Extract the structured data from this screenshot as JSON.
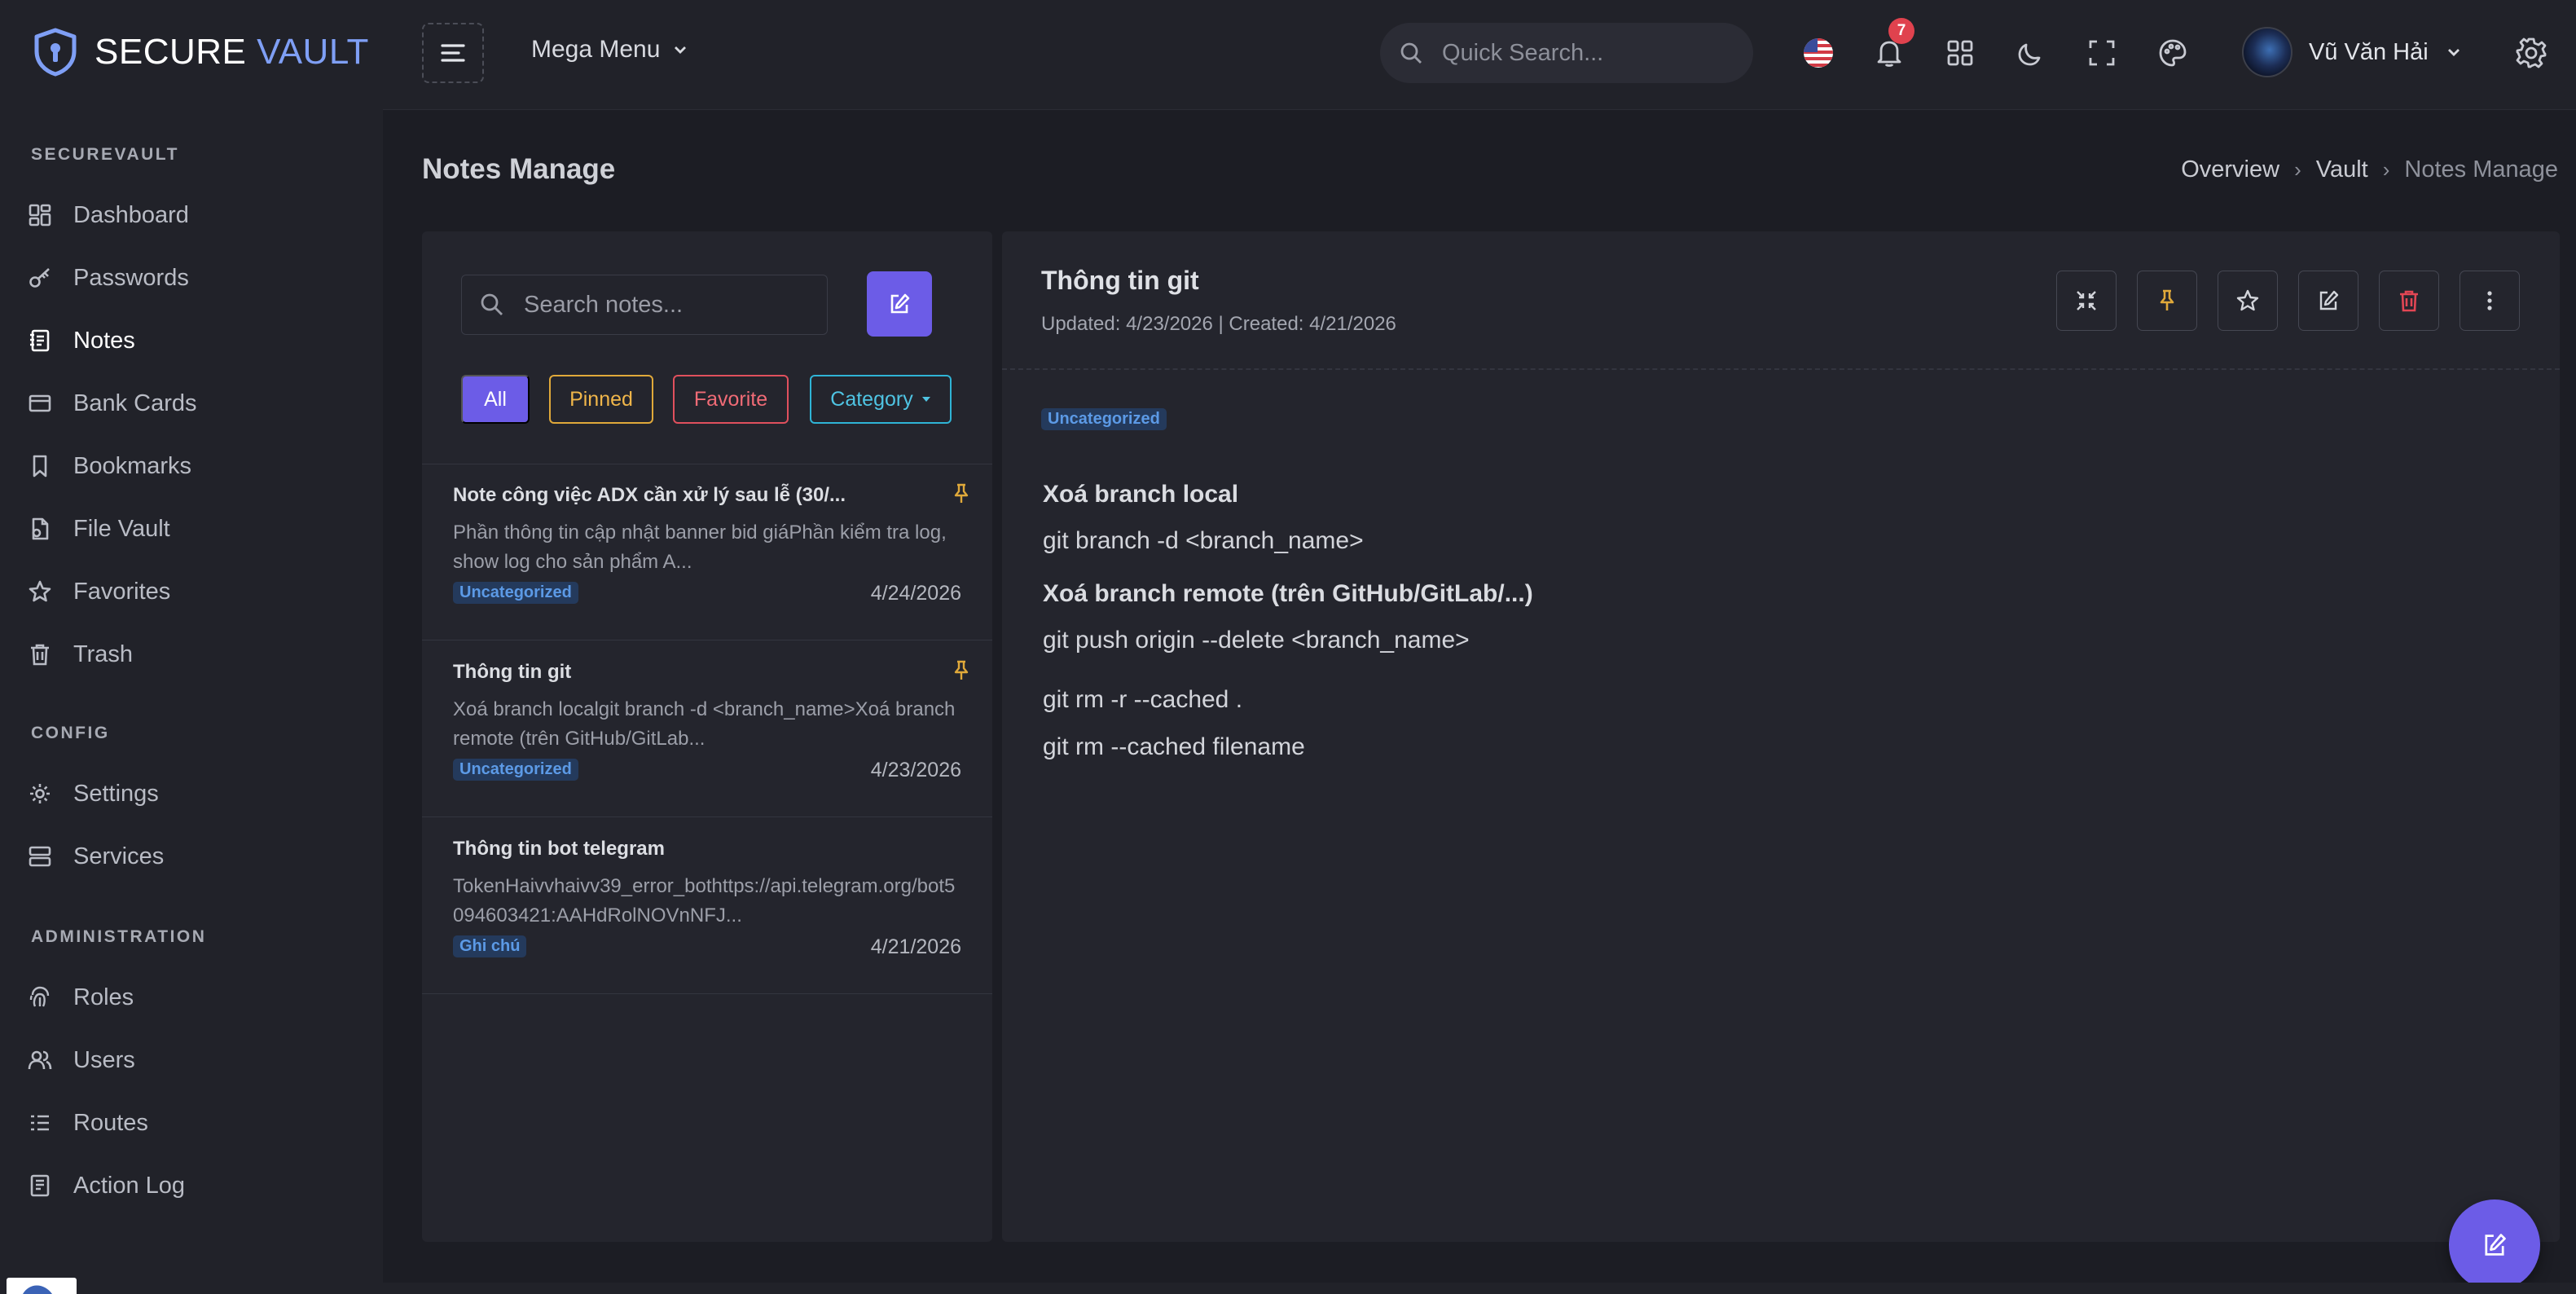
{
  "brand": {
    "name": "SECURE",
    "accent": "VAULT"
  },
  "sidebar": {
    "sections": [
      "SECUREVAULT",
      "CONFIG",
      "ADMINISTRATION"
    ],
    "items": [
      {
        "label": "Dashboard",
        "icon": "dashboard-icon"
      },
      {
        "label": "Passwords",
        "icon": "key-icon"
      },
      {
        "label": "Notes",
        "icon": "notes-icon",
        "active": true
      },
      {
        "label": "Bank Cards",
        "icon": "card-icon"
      },
      {
        "label": "Bookmarks",
        "icon": "bookmark-icon"
      },
      {
        "label": "File Vault",
        "icon": "file-icon"
      },
      {
        "label": "Favorites",
        "icon": "star-icon"
      },
      {
        "label": "Trash",
        "icon": "trash-icon"
      },
      {
        "label": "Settings",
        "icon": "gear-icon"
      },
      {
        "label": "Services",
        "icon": "server-icon"
      },
      {
        "label": "Roles",
        "icon": "fingerprint-icon"
      },
      {
        "label": "Users",
        "icon": "users-icon"
      },
      {
        "label": "Routes",
        "icon": "list-icon"
      },
      {
        "label": "Action Log",
        "icon": "log-icon"
      }
    ]
  },
  "header": {
    "mega_menu": "Mega Menu",
    "search_placeholder": "Quick Search...",
    "notification_count": "7",
    "user_name": "Vũ Văn Hải"
  },
  "page": {
    "title": "Notes Manage",
    "breadcrumb": [
      "Overview",
      "Vault",
      "Notes Manage"
    ]
  },
  "notes_list": {
    "search_placeholder": "Search notes...",
    "filters": {
      "all": "All",
      "pinned": "Pinned",
      "favorite": "Favorite",
      "category": "Category"
    },
    "notes": [
      {
        "title": "Note công việc ADX cần xử lý sau lễ (30/...",
        "preview": "Phần thông tin cập nhật banner bid giáPhần kiểm tra log, show log cho sản phẩm A...",
        "tag": "Uncategorized",
        "date": "4/24/2026",
        "pinned": true
      },
      {
        "title": "Thông tin git",
        "preview": "Xoá branch localgit branch -d <branch_name>Xoá branch remote (trên GitHub/GitLab...",
        "tag": "Uncategorized",
        "date": "4/23/2026",
        "pinned": true
      },
      {
        "title": "Thông tin bot telegram",
        "preview": "TokenHaivvhaivv39_error_bothttps://api.telegram.org/bot5094603421:AAHdRolNOVnNFJ...",
        "tag": "Ghi chú",
        "date": "4/21/2026",
        "pinned": false
      }
    ]
  },
  "detail": {
    "title": "Thông tin git",
    "meta": "Updated: 4/23/2026 | Created: 4/21/2026",
    "tag": "Uncategorized",
    "content": [
      {
        "text": "Xoá branch local",
        "heading": true
      },
      {
        "text": "git branch -d <branch_name>",
        "heading": false
      },
      {
        "text": "Xoá branch remote (trên GitHub/GitLab/...)",
        "heading": true
      },
      {
        "text": "git push origin --delete <branch_name>",
        "heading": false
      },
      {
        "text": "git rm -r --cached .",
        "heading": false
      },
      {
        "text": "git rm --cached filename",
        "heading": false
      }
    ]
  },
  "colors": {
    "accent": "#6c5ce7",
    "pinned": "#e0a93a",
    "favorite": "#e0505d",
    "category": "#2fb4d6",
    "tag_bg": "#243a5c",
    "tag_text": "#5c9ae6"
  }
}
